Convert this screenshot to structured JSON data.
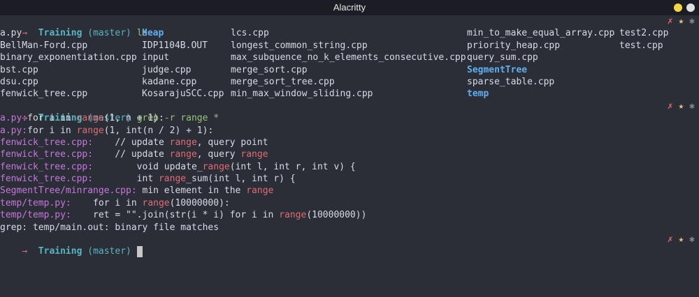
{
  "window": {
    "title": "Alacritty",
    "buttons": {
      "minimize_color": "#f5d547",
      "maximize_color": "#e0e0e0"
    }
  },
  "prompt": {
    "arrow": "→",
    "dir": "Training",
    "branch": "(master)",
    "status_x": "✗",
    "status_star": "★",
    "status_ast": "✱"
  },
  "commands": {
    "ls": "ls",
    "grep": "grep -r range *",
    "empty": ""
  },
  "ls_output": {
    "col1": [
      "a.py",
      "BellMan-Ford.cpp",
      "binary_exponentiation.cpp",
      "bst.cpp",
      "dsu.cpp",
      "fenwick_tree.cpp"
    ],
    "col2": [
      "Heap",
      "IDP1104B.OUT",
      "input",
      "judge.cpp",
      "kadane.cpp",
      "KosarajuSCC.cpp"
    ],
    "col3": [
      "lcs.cpp",
      "longest_common_string.cpp",
      "max_subquence_no_k_elements_consecutive.cpp",
      "merge_sort.cpp",
      "merge_sort_tree.cpp",
      "min_max_window_sliding.cpp"
    ],
    "col4": [
      "min_to_make_equal_array.cpp",
      "priority_heap.cpp",
      "query_sum.cpp",
      "SegmentTree",
      "sparse_table.cpp",
      "temp"
    ],
    "col5": [
      "test2.cpp",
      "test.cpp"
    ]
  },
  "grep_output": [
    {
      "file": "a.py:",
      "pre": "for i in ",
      "match": "range",
      "post": "(1, n + 1):"
    },
    {
      "file": "a.py:",
      "pre": "for i in ",
      "match": "range",
      "post": "(1, int(n / 2) + 1):"
    },
    {
      "file": "fenwick_tree.cpp:",
      "pre": "    // update ",
      "match": "range",
      "post": ", query point"
    },
    {
      "file": "fenwick_tree.cpp:",
      "pre": "    // update ",
      "match": "range",
      "post": ", query ",
      "match2": "range"
    },
    {
      "file": "fenwick_tree.cpp:",
      "pre": "        void update_",
      "match": "range",
      "post": "(int l, int r, int v) {"
    },
    {
      "file": "fenwick_tree.cpp:",
      "pre": "        int ",
      "match": "range",
      "post": "_sum(int l, int r) {"
    },
    {
      "file": "SegmentTree/minrange.cpp:",
      "pre": " min element in the ",
      "match": "range",
      "post": ""
    },
    {
      "file": "temp/temp.py:",
      "pre": "    for i in ",
      "match": "range",
      "post": "(10000000):"
    },
    {
      "file": "temp/temp.py:",
      "pre": "    ret = \"\".join(str(i * i) for i in ",
      "match": "range",
      "post": "(10000000))"
    }
  ],
  "grep_binary_msg": "grep: temp/main.out: binary file matches"
}
